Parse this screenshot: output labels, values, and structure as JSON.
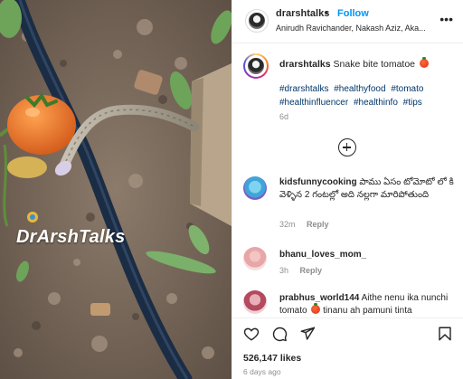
{
  "post": {
    "watermark": "DrArshTalks"
  },
  "header": {
    "username": "drarshtalks",
    "separator": "•",
    "follow_label": "Follow",
    "subtitle": "Anirudh Ravichander, Nakash Aziz, Aka...",
    "more_icon": "more-horizontal-icon"
  },
  "caption": {
    "username": "drarshtalks",
    "text": "Snake bite tomatoe",
    "emoji": "tomato",
    "hashtags": [
      "#drarshtalks",
      "#healthyfood",
      "#tomato",
      "#healthinfluencer",
      "#healthinfo",
      "#tips"
    ],
    "age": "6d"
  },
  "load_more_icon": "plus-circle-icon",
  "comments": [
    {
      "username": "kidsfunnycooking",
      "text": "పాము ఏసం టోమోటో లో కి వెళ్ళిన 2 గంటల్లో అది నల్లగా మారిపోతుంది",
      "age": "32m",
      "reply_label": "Reply"
    },
    {
      "username": "bhanu_loves_mom_",
      "text": "",
      "age": "3h",
      "reply_label": "Reply"
    },
    {
      "username": "prabhus_world144",
      "text": "Aithe nenu ika nunchi tomato",
      "text_tail": "tinanu ah pamuni tinta",
      "age": "",
      "reply_label": ""
    }
  ],
  "actions": {
    "like_icon": "heart-icon",
    "comment_icon": "comment-icon",
    "share_icon": "share-icon",
    "save_icon": "bookmark-icon"
  },
  "likes_count": "526,147 likes",
  "posted_ago": "6 days ago",
  "colors": {
    "link": "#0095f6",
    "hashtag": "#00376b",
    "muted": "#8e8e8e"
  }
}
